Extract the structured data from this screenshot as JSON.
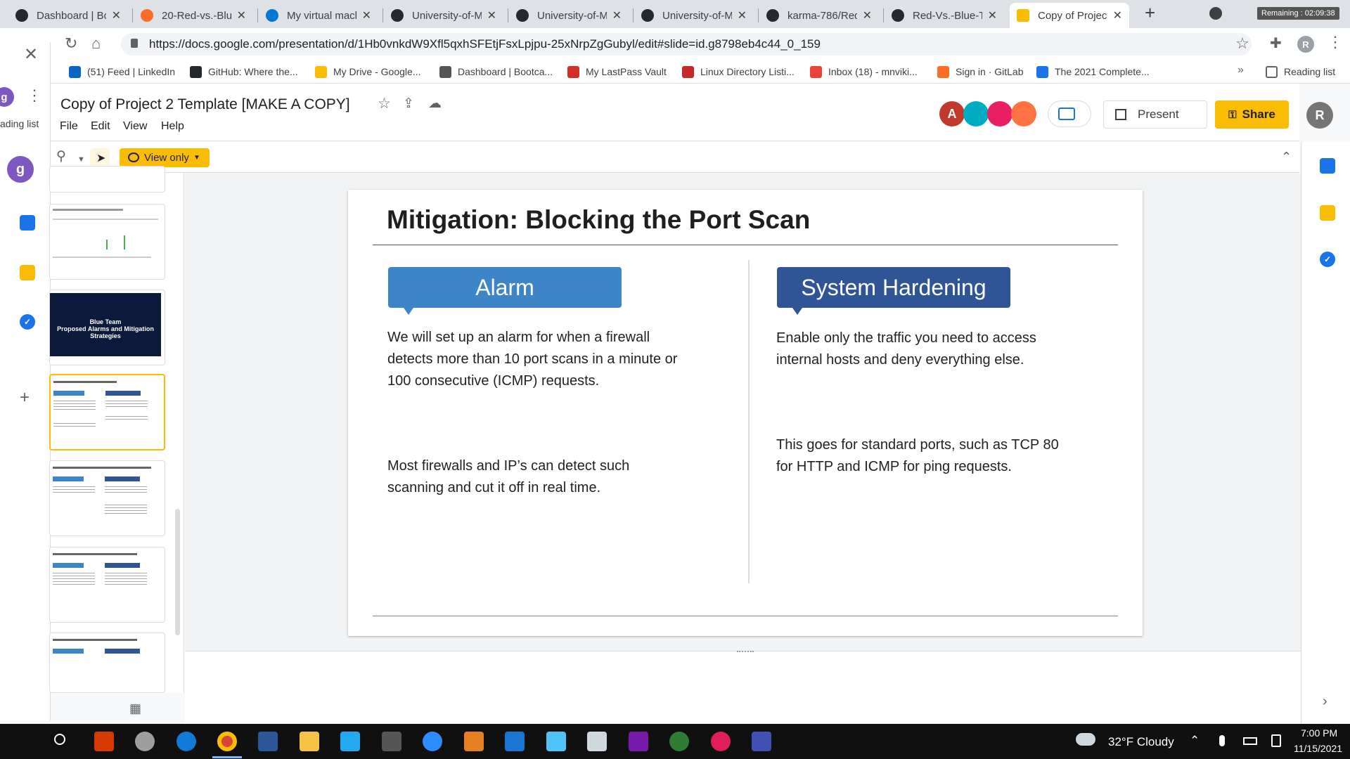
{
  "tabs": [
    {
      "label": "Dashboard | Bo",
      "icon": "github-icon"
    },
    {
      "label": "20-Red-vs.-Blue",
      "icon": "gitlab-icon"
    },
    {
      "label": "My virtual mach",
      "icon": "azure-icon"
    },
    {
      "label": "University-of-M",
      "icon": "github-icon"
    },
    {
      "label": "University-of-M",
      "icon": "github-icon"
    },
    {
      "label": "University-of-M",
      "icon": "github-icon"
    },
    {
      "label": "karma-786/Red",
      "icon": "github-icon"
    },
    {
      "label": "Red-Vs.-Blue-Te",
      "icon": "github-icon"
    },
    {
      "label": "Copy of Project",
      "icon": "slides-icon"
    }
  ],
  "remaining_label": "Remaining : 02:09:38",
  "url": "https://docs.google.com/presentation/d/1Hb0vnkdW9Xfl5qxhSFEtjFsxLpjpu-25xNrpZgGubyl/edit#slide=id.g8798eb4c44_0_159",
  "profile_initial": "R",
  "bookmarks": [
    {
      "label": "(51) Feed | LinkedIn",
      "color": "#0a66c2"
    },
    {
      "label": "GitHub: Where the...",
      "color": "#24292e"
    },
    {
      "label": "My Drive - Google...",
      "color": "#fbbc04"
    },
    {
      "label": "Dashboard | Bootca...",
      "color": "#555555"
    },
    {
      "label": "My LastPass Vault",
      "color": "#d32d27"
    },
    {
      "label": "Linux Directory Listi...",
      "color": "#c62828"
    },
    {
      "label": "Inbox (18) - mnviki...",
      "color": "#ea4335"
    },
    {
      "label": "Sign in · GitLab",
      "color": "#fc6d26"
    },
    {
      "label": "The 2021 Complete...",
      "color": "#1a73e8"
    }
  ],
  "reading_list_label": "Reading list",
  "side_reading_list": "ading list",
  "side_avatar": "g",
  "doc_title": "Copy of Project 2 Template [MAKE A COPY]",
  "menus": [
    "File",
    "Edit",
    "View",
    "Help"
  ],
  "view_only_label": "View only",
  "present_label": "Present",
  "share_label": "Share",
  "collab_initial": "A",
  "account_initial": "R",
  "thumb_blue_team": "Blue Team\nProposed Alarms and Mitigation Strategies",
  "slide": {
    "title": "Mitigation: Blocking the Port Scan",
    "alarm_label": "Alarm",
    "hardening_label": "System Hardening",
    "alarm_p1": "We will set up an alarm for when a firewall detects more than 10 port scans in a minute or 100 consecutive (ICMP) requests.",
    "alarm_p2": "Most firewalls and IP’s can detect such scanning and cut it off in real time.",
    "hardening_p1": "Enable only the traffic you need to access internal hosts and deny everything else.",
    "hardening_p2": "This goes for standard ports, such as TCP 80 for HTTP and ICMP for ping requests."
  },
  "colors": {
    "alarm": "#3d85c6",
    "hardening": "#2f5597",
    "share": "#fbbc04"
  },
  "taskbar": {
    "weather": "32°F  Cloudy",
    "time": "7:00 PM",
    "date": "11/15/2021"
  }
}
